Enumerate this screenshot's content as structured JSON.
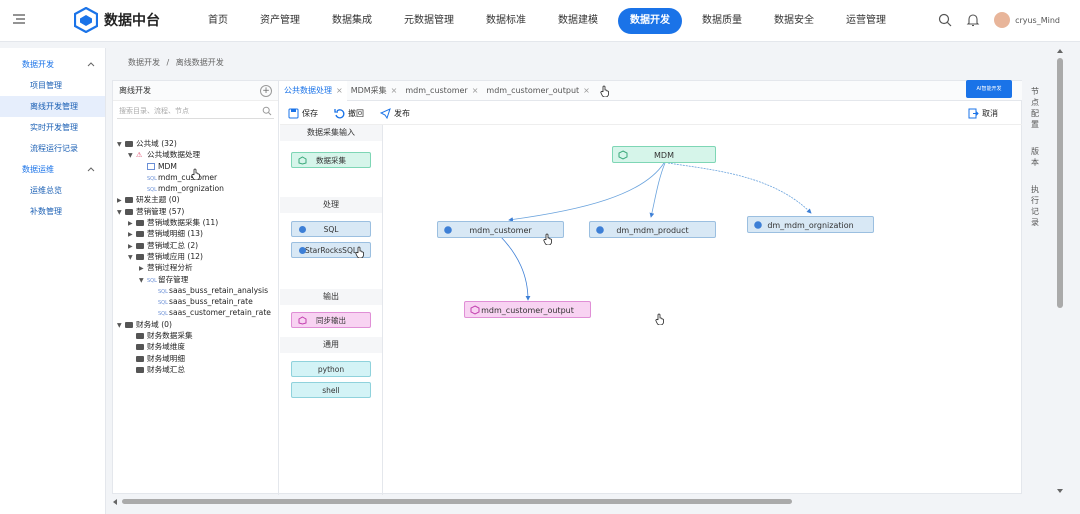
{
  "app": {
    "title": "数据中台",
    "user": "cryus_Mind"
  },
  "nav": [
    {
      "label": "首页",
      "active": false
    },
    {
      "label": "资产管理",
      "active": false
    },
    {
      "label": "数据集成",
      "active": false
    },
    {
      "label": "元数据管理",
      "active": false
    },
    {
      "label": "数据标准",
      "active": false
    },
    {
      "label": "数据建模",
      "active": false
    },
    {
      "label": "数据开发",
      "active": true
    },
    {
      "label": "数据质量",
      "active": false
    },
    {
      "label": "数据安全",
      "active": false
    },
    {
      "label": "运营管理",
      "active": false
    }
  ],
  "sidebar": {
    "group1": {
      "label": "数据开发"
    },
    "group1_items": [
      {
        "label": "项目管理",
        "active": false
      },
      {
        "label": "离线开发管理",
        "active": true
      },
      {
        "label": "实时开发管理",
        "active": false
      },
      {
        "label": "流程运行记录",
        "active": false
      }
    ],
    "group2": {
      "label": "数据运维"
    },
    "group2_items": [
      {
        "label": "运维总览",
        "active": false
      },
      {
        "label": "补数管理",
        "active": false
      }
    ]
  },
  "breadcrumb": {
    "parent": "数据开发",
    "sep": "/",
    "current": "离线数据开发"
  },
  "tree": {
    "title": "离线开发",
    "search_placeholder": "搜索目录、流程、节点",
    "nodes": [
      {
        "label": "公共域 (32)",
        "indent": 0,
        "icon": "folder",
        "arrow": "down"
      },
      {
        "label": "公共域数据处理",
        "indent": 1,
        "icon": "flow",
        "arrow": "down"
      },
      {
        "label": "MDM",
        "indent": 2,
        "icon": "table",
        "arrow": ""
      },
      {
        "label": "mdm_customer",
        "indent": 2,
        "icon": "sql",
        "arrow": ""
      },
      {
        "label": "mdm_orgnization",
        "indent": 2,
        "icon": "sql",
        "arrow": ""
      },
      {
        "label": "研发主题 (0)",
        "indent": 0,
        "icon": "folder",
        "arrow": "right"
      },
      {
        "label": "营销管理 (57)",
        "indent": 0,
        "icon": "folder",
        "arrow": "down"
      },
      {
        "label": "营销域数据采集 (11)",
        "indent": 1,
        "icon": "folder",
        "arrow": "right"
      },
      {
        "label": "营销域明细 (13)",
        "indent": 1,
        "icon": "folder",
        "arrow": "right"
      },
      {
        "label": "营销域汇总 (2)",
        "indent": 1,
        "icon": "folder",
        "arrow": "right"
      },
      {
        "label": "营销域应用 (12)",
        "indent": 1,
        "icon": "folder",
        "arrow": "down"
      },
      {
        "label": "营销过程分析",
        "indent": 2,
        "icon": "none",
        "arrow": "right"
      },
      {
        "label": "留存管理",
        "indent": 2,
        "icon": "sql",
        "arrow": "down"
      },
      {
        "label": "saas_buss_retain_analysis",
        "indent": 3,
        "icon": "sql",
        "arrow": ""
      },
      {
        "label": "saas_buss_retain_rate",
        "indent": 3,
        "icon": "sql",
        "arrow": ""
      },
      {
        "label": "saas_customer_retain_rate",
        "indent": 3,
        "icon": "sql",
        "arrow": ""
      },
      {
        "label": "财务域 (0)",
        "indent": 0,
        "icon": "folder",
        "arrow": "down"
      },
      {
        "label": "财务数据采集",
        "indent": 1,
        "icon": "folder",
        "arrow": ""
      },
      {
        "label": "财务域维度",
        "indent": 1,
        "icon": "folder",
        "arrow": ""
      },
      {
        "label": "财务域明细",
        "indent": 1,
        "icon": "folder",
        "arrow": ""
      },
      {
        "label": "财务域汇总",
        "indent": 1,
        "icon": "folder",
        "arrow": ""
      }
    ]
  },
  "tabs": [
    {
      "label": "公共数据处理",
      "active": true
    },
    {
      "label": "MDM采集",
      "active": false
    },
    {
      "label": "mdm_customer",
      "active": false
    },
    {
      "label": "mdm_customer_output",
      "active": false
    }
  ],
  "ai_button": "AI智能开发",
  "toolbar": {
    "save": "保存",
    "undo": "撤回",
    "publish": "发布",
    "cancel": "取消"
  },
  "palette": {
    "sections": [
      {
        "title": "数据采集输入",
        "items": [
          {
            "label": "数据采集",
            "color": "green"
          }
        ]
      },
      {
        "title": "处理",
        "items": [
          {
            "label": "SQL",
            "color": "blue"
          },
          {
            "label": "StarRocksSQL",
            "color": "blue"
          }
        ]
      },
      {
        "title": "输出",
        "items": [
          {
            "label": "同步输出",
            "color": "pink"
          }
        ]
      },
      {
        "title": "通用",
        "items": [
          {
            "label": "python",
            "color": "cyan"
          },
          {
            "label": "shell",
            "color": "cyan"
          }
        ]
      }
    ]
  },
  "canvas": {
    "nodes": [
      {
        "id": "mdm",
        "label": "MDM",
        "color": "green"
      },
      {
        "id": "customer",
        "label": "mdm_customer",
        "color": "blue"
      },
      {
        "id": "product",
        "label": "dm_mdm_product",
        "color": "blue"
      },
      {
        "id": "org",
        "label": "dm_mdm_orgnization",
        "color": "blue"
      },
      {
        "id": "output",
        "label": "mdm_customer_output",
        "color": "pink"
      }
    ]
  },
  "right_panel": {
    "items": [
      "节点配置",
      "版本",
      "执行记录"
    ]
  }
}
